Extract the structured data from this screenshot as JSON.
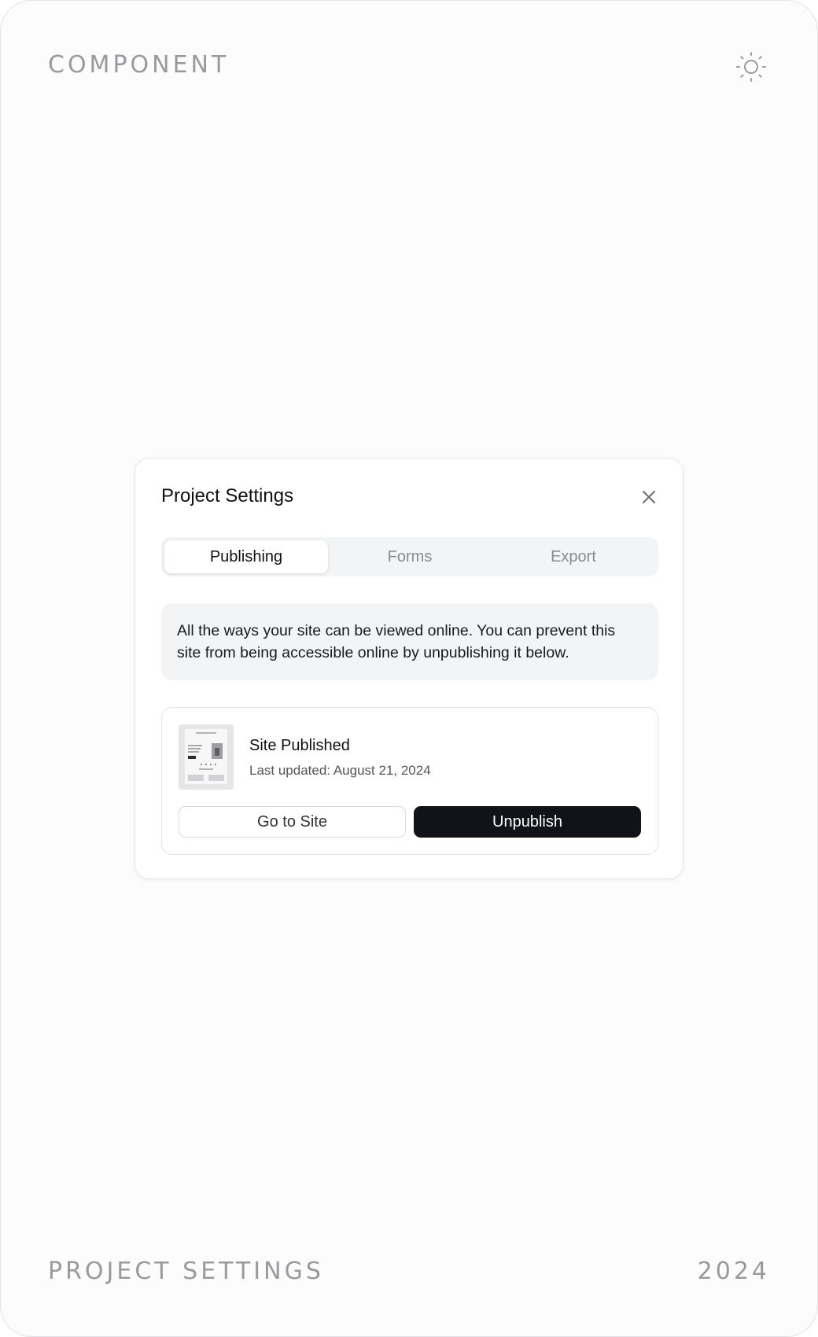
{
  "corners": {
    "top_left": "COMPONENT",
    "bottom_left": "PROJECT SETTINGS",
    "bottom_right": "2024",
    "theme_icon": "sun-icon"
  },
  "dialog": {
    "title": "Project Settings",
    "close_icon": "close-icon",
    "tabs": [
      {
        "label": "Publishing",
        "active": true
      },
      {
        "label": "Forms",
        "active": false
      },
      {
        "label": "Export",
        "active": false
      }
    ],
    "info_text": "All the ways your site can be viewed online. You can prevent this site from being accessible online by unpublishing it below.",
    "site": {
      "thumbnail": "site-thumbnail",
      "status": "Site Published",
      "last_updated": "Last updated: August 21, 2024",
      "go_to_site_label": "Go to Site",
      "unpublish_label": "Unpublish"
    }
  },
  "colors": {
    "primary_button": "#111318",
    "muted_text": "#8b8b90",
    "surface": "#f3f4f6"
  }
}
